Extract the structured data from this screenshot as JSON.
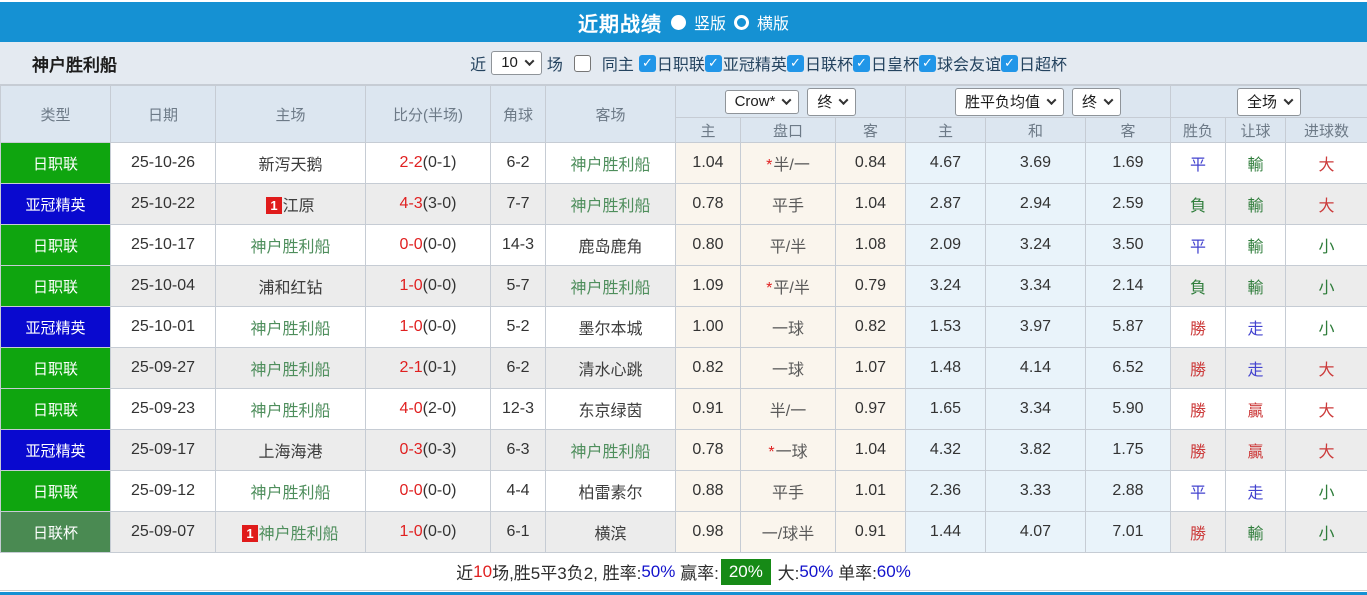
{
  "titlebar": {
    "title": "近期战绩",
    "radios": [
      {
        "label": "竖版",
        "selected": true
      },
      {
        "label": "横版",
        "selected": false
      }
    ]
  },
  "filter": {
    "team": "神户胜利船",
    "recent_label": "近",
    "recent_value": "10",
    "matches_label": "场",
    "same_home": {
      "label": "同主",
      "checked": false
    },
    "leagues": [
      {
        "label": "日职联",
        "checked": true
      },
      {
        "label": "亚冠精英",
        "checked": true
      },
      {
        "label": "日联杯",
        "checked": true
      },
      {
        "label": "日皇杯",
        "checked": true
      },
      {
        "label": "球会友谊",
        "checked": true
      },
      {
        "label": "日超杯",
        "checked": true
      }
    ]
  },
  "table": {
    "main_headers": [
      "类型",
      "日期",
      "主场",
      "比分(半场)",
      "角球",
      "客场"
    ],
    "sub_headers": [
      "主",
      "盘口",
      "客",
      "主",
      "和",
      "客",
      "胜负",
      "让球",
      "进球数"
    ],
    "selects": {
      "company": "Crow*",
      "company_time": "终",
      "avg": "胜平负均值",
      "avg_time": "终",
      "scope": "全场"
    },
    "rows": [
      {
        "type": "日职联",
        "type_key": "j1",
        "date": "25-10-26",
        "home": {
          "name": "新泻天鹅",
          "focus": false,
          "card": null
        },
        "score": "2-2",
        "half": "(0-1)",
        "corner": "6-2",
        "away": {
          "name": "神户胜利船",
          "focus": true,
          "card": null
        },
        "odds": {
          "home": "1.04",
          "handicap": "半/一",
          "star": true,
          "away": "0.84"
        },
        "avg": {
          "home": "4.67",
          "draw": "3.69",
          "away": "1.69"
        },
        "result": {
          "text": "平",
          "color": "blue"
        },
        "letgoal": {
          "text": "輸",
          "color": "green"
        },
        "goals": {
          "text": "大",
          "color": "red"
        }
      },
      {
        "type": "亚冠精英",
        "type_key": "acl",
        "date": "25-10-22",
        "home": {
          "name": "江原",
          "focus": false,
          "card": "1"
        },
        "score": "4-3",
        "half": "(3-0)",
        "corner": "7-7",
        "away": {
          "name": "神户胜利船",
          "focus": true,
          "card": null
        },
        "odds": {
          "home": "0.78",
          "handicap": "平手",
          "star": false,
          "away": "1.04"
        },
        "avg": {
          "home": "2.87",
          "draw": "2.94",
          "away": "2.59"
        },
        "result": {
          "text": "負",
          "color": "green"
        },
        "letgoal": {
          "text": "輸",
          "color": "green"
        },
        "goals": {
          "text": "大",
          "color": "red"
        }
      },
      {
        "type": "日职联",
        "type_key": "j1",
        "date": "25-10-17",
        "home": {
          "name": "神户胜利船",
          "focus": true,
          "card": null
        },
        "score": "0-0",
        "half": "(0-0)",
        "corner": "14-3",
        "away": {
          "name": "鹿岛鹿角",
          "focus": false,
          "card": null
        },
        "odds": {
          "home": "0.80",
          "handicap": "平/半",
          "star": false,
          "away": "1.08"
        },
        "avg": {
          "home": "2.09",
          "draw": "3.24",
          "away": "3.50"
        },
        "result": {
          "text": "平",
          "color": "blue"
        },
        "letgoal": {
          "text": "輸",
          "color": "green"
        },
        "goals": {
          "text": "小",
          "color": "green"
        }
      },
      {
        "type": "日职联",
        "type_key": "j1",
        "date": "25-10-04",
        "home": {
          "name": "浦和红钻",
          "focus": false,
          "card": null
        },
        "score": "1-0",
        "half": "(0-0)",
        "corner": "5-7",
        "away": {
          "name": "神户胜利船",
          "focus": true,
          "card": null
        },
        "odds": {
          "home": "1.09",
          "handicap": "平/半",
          "star": true,
          "away": "0.79"
        },
        "avg": {
          "home": "3.24",
          "draw": "3.34",
          "away": "2.14"
        },
        "result": {
          "text": "負",
          "color": "green"
        },
        "letgoal": {
          "text": "輸",
          "color": "green"
        },
        "goals": {
          "text": "小",
          "color": "green"
        }
      },
      {
        "type": "亚冠精英",
        "type_key": "acl",
        "date": "25-10-01",
        "home": {
          "name": "神户胜利船",
          "focus": true,
          "card": null
        },
        "score": "1-0",
        "half": "(0-0)",
        "corner": "5-2",
        "away": {
          "name": "墨尔本城",
          "focus": false,
          "card": null
        },
        "odds": {
          "home": "1.00",
          "handicap": "一球",
          "star": false,
          "away": "0.82"
        },
        "avg": {
          "home": "1.53",
          "draw": "3.97",
          "away": "5.87"
        },
        "result": {
          "text": "勝",
          "color": "red"
        },
        "letgoal": {
          "text": "走",
          "color": "blue"
        },
        "goals": {
          "text": "小",
          "color": "green"
        }
      },
      {
        "type": "日职联",
        "type_key": "j1",
        "date": "25-09-27",
        "home": {
          "name": "神户胜利船",
          "focus": true,
          "card": null
        },
        "score": "2-1",
        "half": "(0-1)",
        "corner": "6-2",
        "away": {
          "name": "清水心跳",
          "focus": false,
          "card": null
        },
        "odds": {
          "home": "0.82",
          "handicap": "一球",
          "star": false,
          "away": "1.07"
        },
        "avg": {
          "home": "1.48",
          "draw": "4.14",
          "away": "6.52"
        },
        "result": {
          "text": "勝",
          "color": "red"
        },
        "letgoal": {
          "text": "走",
          "color": "blue"
        },
        "goals": {
          "text": "大",
          "color": "red"
        }
      },
      {
        "type": "日职联",
        "type_key": "j1",
        "date": "25-09-23",
        "home": {
          "name": "神户胜利船",
          "focus": true,
          "card": null
        },
        "score": "4-0",
        "half": "(2-0)",
        "corner": "12-3",
        "away": {
          "name": "东京绿茵",
          "focus": false,
          "card": null
        },
        "odds": {
          "home": "0.91",
          "handicap": "半/一",
          "star": false,
          "away": "0.97"
        },
        "avg": {
          "home": "1.65",
          "draw": "3.34",
          "away": "5.90"
        },
        "result": {
          "text": "勝",
          "color": "red"
        },
        "letgoal": {
          "text": "贏",
          "color": "red"
        },
        "goals": {
          "text": "大",
          "color": "red"
        }
      },
      {
        "type": "亚冠精英",
        "type_key": "acl",
        "date": "25-09-17",
        "home": {
          "name": "上海海港",
          "focus": false,
          "card": null
        },
        "score": "0-3",
        "half": "(0-3)",
        "corner": "6-3",
        "away": {
          "name": "神户胜利船",
          "focus": true,
          "card": null
        },
        "odds": {
          "home": "0.78",
          "handicap": "一球",
          "star": true,
          "away": "1.04"
        },
        "avg": {
          "home": "4.32",
          "draw": "3.82",
          "away": "1.75"
        },
        "result": {
          "text": "勝",
          "color": "red"
        },
        "letgoal": {
          "text": "贏",
          "color": "red"
        },
        "goals": {
          "text": "大",
          "color": "red"
        }
      },
      {
        "type": "日职联",
        "type_key": "j1",
        "date": "25-09-12",
        "home": {
          "name": "神户胜利船",
          "focus": true,
          "card": null
        },
        "score": "0-0",
        "half": "(0-0)",
        "corner": "4-4",
        "away": {
          "name": "柏雷素尔",
          "focus": false,
          "card": null
        },
        "odds": {
          "home": "0.88",
          "handicap": "平手",
          "star": false,
          "away": "1.01"
        },
        "avg": {
          "home": "2.36",
          "draw": "3.33",
          "away": "2.88"
        },
        "result": {
          "text": "平",
          "color": "blue"
        },
        "letgoal": {
          "text": "走",
          "color": "blue"
        },
        "goals": {
          "text": "小",
          "color": "green"
        }
      },
      {
        "type": "日联杯",
        "type_key": "cup",
        "date": "25-09-07",
        "home": {
          "name": "神户胜利船",
          "focus": true,
          "card": "1"
        },
        "score": "1-0",
        "half": "(0-0)",
        "corner": "6-1",
        "away": {
          "name": "横滨",
          "focus": false,
          "card": null
        },
        "odds": {
          "home": "0.98",
          "handicap": "一/球半",
          "star": false,
          "away": "0.91"
        },
        "avg": {
          "home": "1.44",
          "draw": "4.07",
          "away": "7.01"
        },
        "result": {
          "text": "勝",
          "color": "red"
        },
        "letgoal": {
          "text": "輸",
          "color": "green"
        },
        "goals": {
          "text": "小",
          "color": "green"
        }
      }
    ]
  },
  "summary": {
    "segments": [
      {
        "text": "近",
        "style": "plain"
      },
      {
        "text": "10",
        "style": "red"
      },
      {
        "text": "场,胜5平3负2, 胜率:",
        "style": "plain"
      },
      {
        "text": "50%",
        "style": "blue"
      },
      {
        "text": " 赢率:",
        "style": "plain"
      },
      {
        "text": "20%",
        "style": "greenbadge"
      },
      {
        "text": " 大:",
        "style": "plain"
      },
      {
        "text": "50%",
        "style": "blue"
      },
      {
        "text": " 单率:",
        "style": "plain"
      },
      {
        "text": "60%",
        "style": "blue"
      }
    ]
  },
  "colors": {
    "topbar_blue": "#1591d3",
    "type_colors": {
      "j1": "#0fa50f",
      "acl": "#0909cf",
      "cup": "#4a8a52"
    },
    "focus_team_green": "#4e8e5c",
    "score_red": "#e02020",
    "result_red": "#cc3b3b",
    "result_blue": "#4343cf",
    "result_green": "#2f7d3b",
    "summary_badge_green": "#168a16",
    "checkbox_blue": "#2196e8"
  }
}
